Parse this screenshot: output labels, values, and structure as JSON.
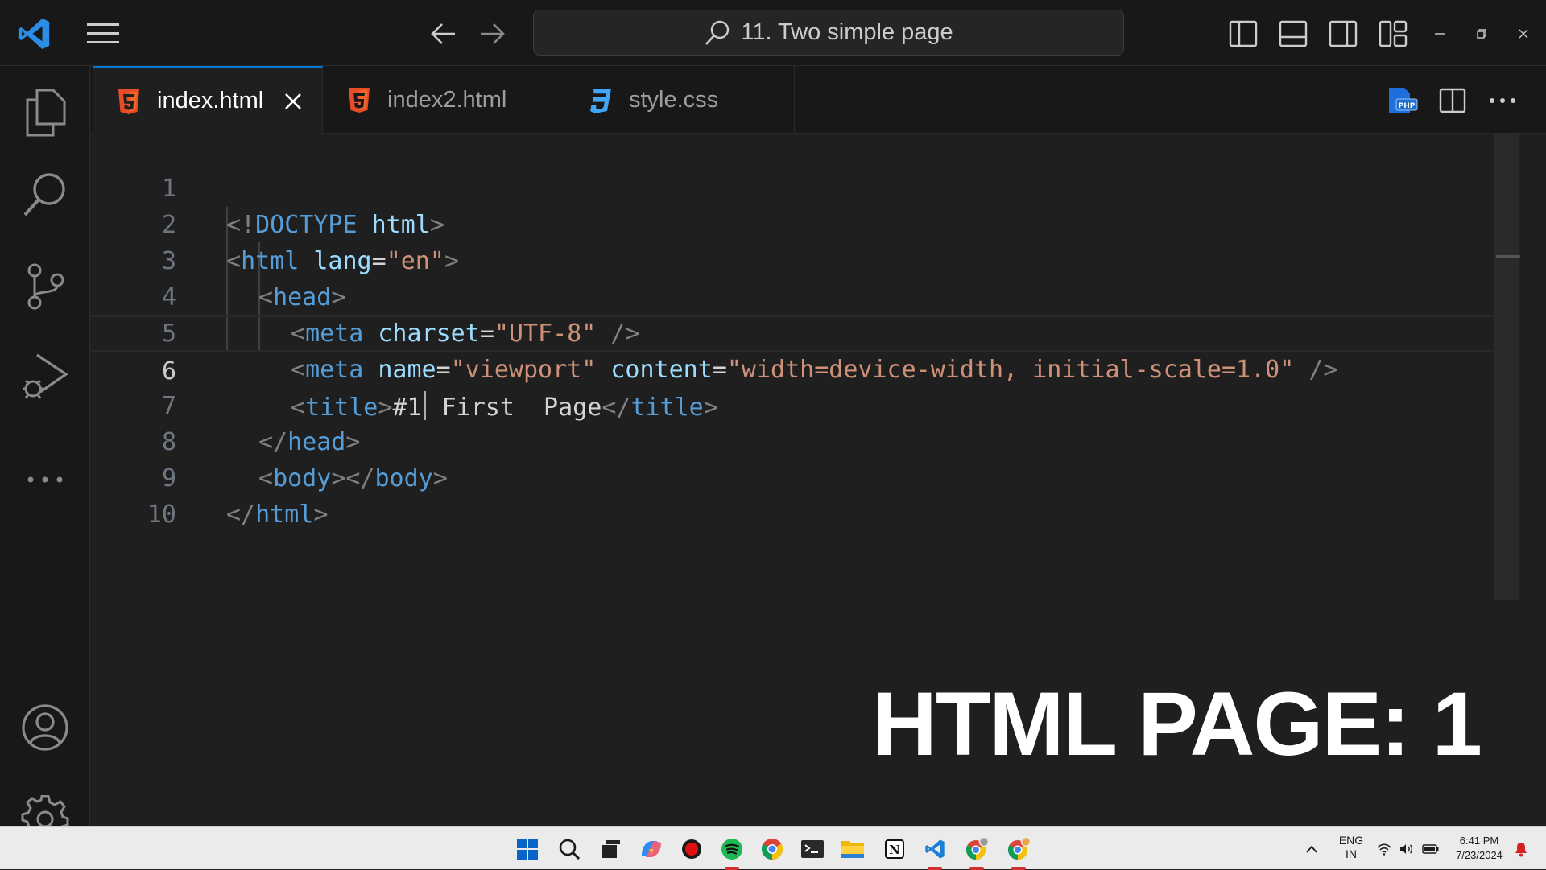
{
  "window": {
    "search_text": "11. Two simple page",
    "app_icon": "vscode-icon"
  },
  "tabs": [
    {
      "label": "index.html",
      "icon": "html5-icon",
      "active": true
    },
    {
      "label": "index2.html",
      "icon": "html5-icon",
      "active": false
    },
    {
      "label": "style.css",
      "icon": "css3-icon",
      "active": false
    }
  ],
  "activity_bar": [
    "explorer-icon",
    "search-icon",
    "source-control-icon",
    "run-debug-icon",
    "more-icon",
    "accounts-icon",
    "settings-gear-icon"
  ],
  "editor": {
    "line_numbers": [
      "1",
      "2",
      "3",
      "4",
      "5",
      "6",
      "7",
      "8",
      "9",
      "10"
    ],
    "current_line": "6",
    "lines": [
      [
        "<!",
        "DOCTYPE",
        " ",
        "html",
        ">"
      ],
      [
        "<",
        "html",
        " ",
        "lang",
        "=",
        "\"en\"",
        ">"
      ],
      [
        "<",
        "head",
        ">"
      ],
      [
        "<",
        "meta",
        " ",
        "charset",
        "=",
        "\"UTF-8\"",
        " />"
      ],
      [
        "<",
        "meta",
        " ",
        "name",
        "=",
        "\"viewport\"",
        " ",
        "content",
        "=",
        "\"width=device-width, initial-scale=1.0\"",
        " />"
      ],
      [
        "<",
        "title",
        ">",
        "#1",
        " First  Page",
        "</",
        "title",
        ">"
      ],
      [
        "</",
        "head",
        ">"
      ],
      [
        "<",
        "body",
        "></",
        "body",
        ">"
      ],
      [
        "</",
        "html",
        ">"
      ]
    ]
  },
  "overlay_caption": "HTML PAGE: 1",
  "taskbar": {
    "apps": [
      "windows-start-icon",
      "search-icon",
      "task-view-icon",
      "copilot-icon",
      "record-icon",
      "spotify-icon",
      "chrome-icon",
      "terminal-icon",
      "file-explorer-icon",
      "notion-icon",
      "vscode-icon",
      "chrome-profile-icon",
      "chrome-profile-2-icon"
    ],
    "lang_top": "ENG",
    "lang_bottom": "IN",
    "time": "6:41 PM",
    "date": "7/23/2024"
  },
  "colors": {
    "accent": "#0078d4",
    "html_icon": "#e44d26",
    "css_icon": "#42a5f5"
  }
}
